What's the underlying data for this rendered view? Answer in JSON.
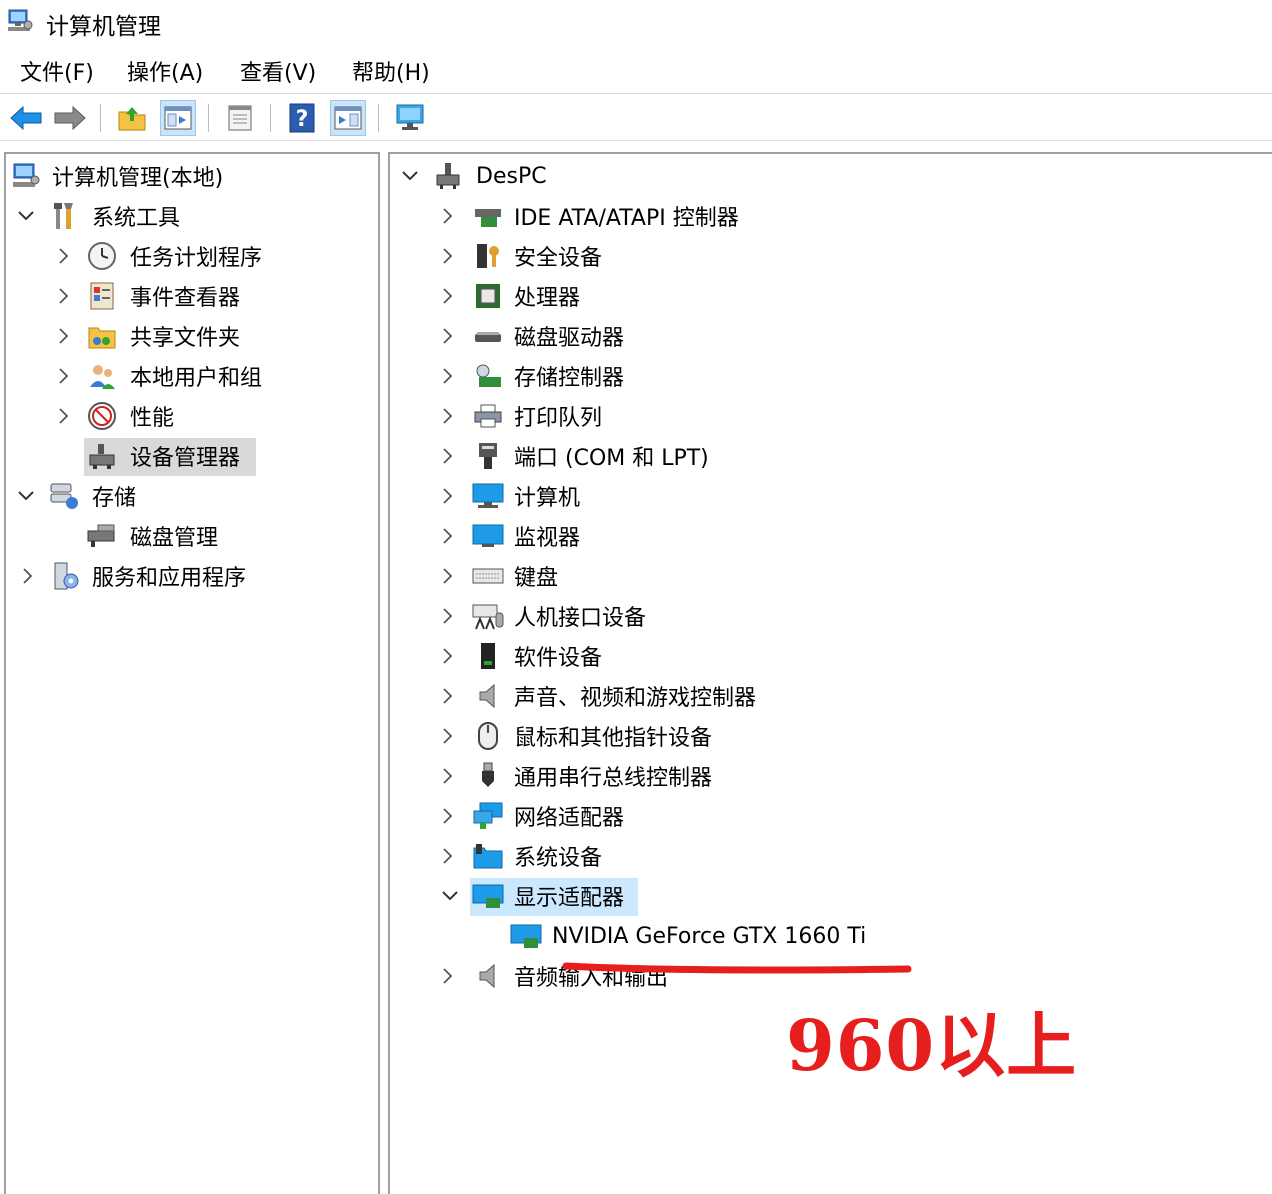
{
  "window": {
    "title": "计算机管理"
  },
  "menu": [
    "文件(F)",
    "操作(A)",
    "查看(V)",
    "帮助(H)"
  ],
  "left_tree": {
    "root": "计算机管理(本地)",
    "system_tools": "系统工具",
    "task_scheduler": "任务计划程序",
    "event_viewer": "事件查看器",
    "shared_folders": "共享文件夹",
    "local_users": "本地用户和组",
    "performance": "性能",
    "device_manager": "设备管理器",
    "storage": "存储",
    "disk_management": "磁盘管理",
    "services_apps": "服务和应用程序"
  },
  "device_tree": {
    "computer_name": "DesPC",
    "categories": [
      "IDE ATA/ATAPI 控制器",
      "安全设备",
      "处理器",
      "磁盘驱动器",
      "存储控制器",
      "打印队列",
      "端口 (COM 和 LPT)",
      "计算机",
      "监视器",
      "键盘",
      "人机接口设备",
      "软件设备",
      "声音、视频和游戏控制器",
      "鼠标和其他指针设备",
      "通用串行总线控制器",
      "网络适配器",
      "系统设备",
      "显示适配器"
    ],
    "display_adapter_child": "NVIDIA GeForce GTX 1660 Ti",
    "last_category": "音频输入和输出"
  },
  "annotation": {
    "text": "960以上",
    "color": "#e61e1e"
  },
  "colors": {
    "selection": "#cce8ff",
    "selection_gray": "#d9d9d9",
    "pane_border": "#a0a0a0"
  }
}
